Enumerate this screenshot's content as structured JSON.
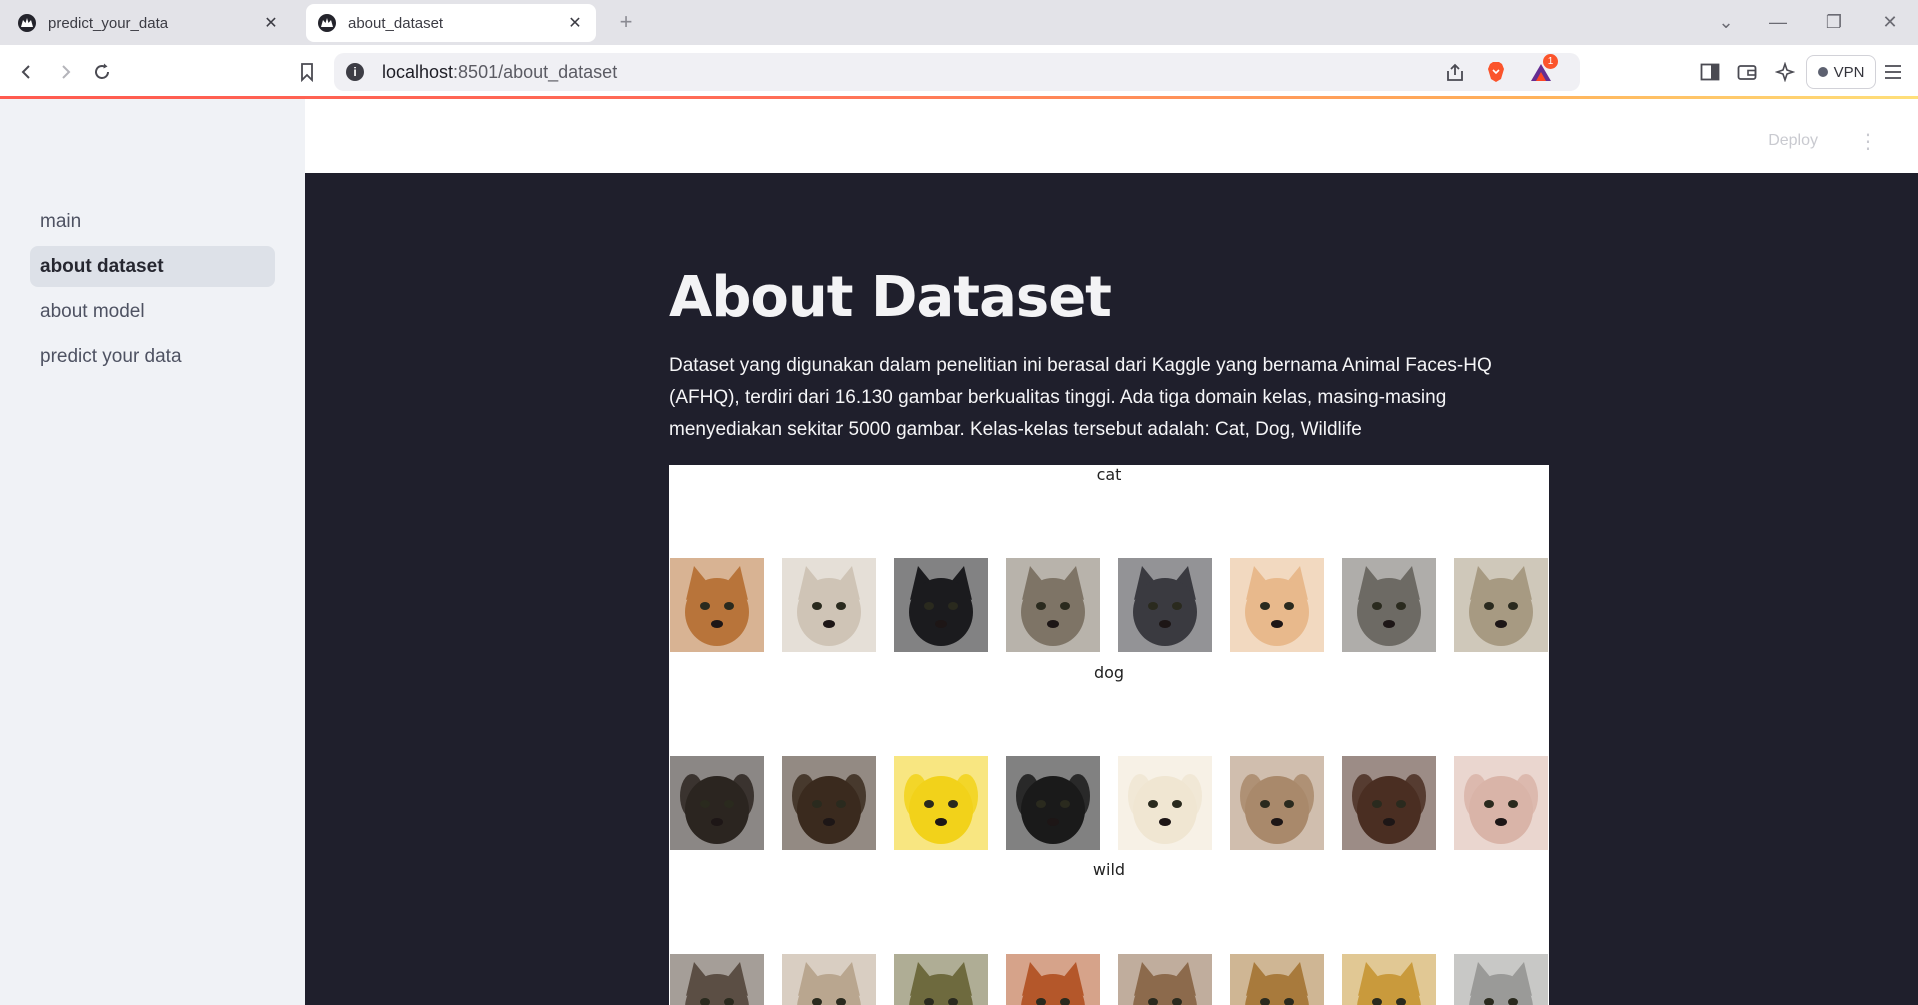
{
  "browser": {
    "tabs": [
      {
        "title": "predict_your_data",
        "active": false
      },
      {
        "title": "about_dataset",
        "active": true
      }
    ],
    "url_host": "localhost",
    "url_rest": ":8501/about_dataset",
    "vpn_label": "VPN",
    "brave_badge": "1"
  },
  "header": {
    "deploy_label": "Deploy"
  },
  "sidebar": {
    "items": [
      {
        "label": "main",
        "active": false
      },
      {
        "label": "about dataset",
        "active": true
      },
      {
        "label": "about model",
        "active": false
      },
      {
        "label": "predict your data",
        "active": false
      }
    ]
  },
  "main": {
    "title": "About Dataset",
    "intro": "Dataset yang digunakan dalam penelitian ini berasal dari Kaggle yang bernama Animal Faces-HQ (AFHQ), terdiri dari 16.130 gambar berkualitas tinggi. Ada tiga domain kelas, masing-masing menyediakan sekitar 5000 gambar. Kelas-kelas tersebut adalah: Cat, Dog, Wildlife"
  },
  "figure": {
    "rows": [
      {
        "title": "cat",
        "colors": [
          "#b8743a",
          "#cfc4b6",
          "#1b1b1e",
          "#7e7466",
          "#3a3a40",
          "#e8b98c",
          "#6d6a64",
          "#a79a82"
        ]
      },
      {
        "title": "dog",
        "colors": [
          "#2b2520",
          "#3a2a1e",
          "#f2d21a",
          "#1a1a1a",
          "#f0e6d2",
          "#a9896b",
          "#4a2e22",
          "#d9b4a8"
        ]
      },
      {
        "title": "wild",
        "colors": [
          "#5b4e44",
          "#b9a68f",
          "#6e6a3e",
          "#b4572a",
          "#8c6a4c",
          "#a87a3c",
          "#c99a3c",
          "#9a9a98"
        ]
      }
    ]
  },
  "colors": {
    "main_bg": "#1f1f2c",
    "sidebar_bg": "#f0f2f6",
    "accent_loading": "#ff5a4f"
  }
}
